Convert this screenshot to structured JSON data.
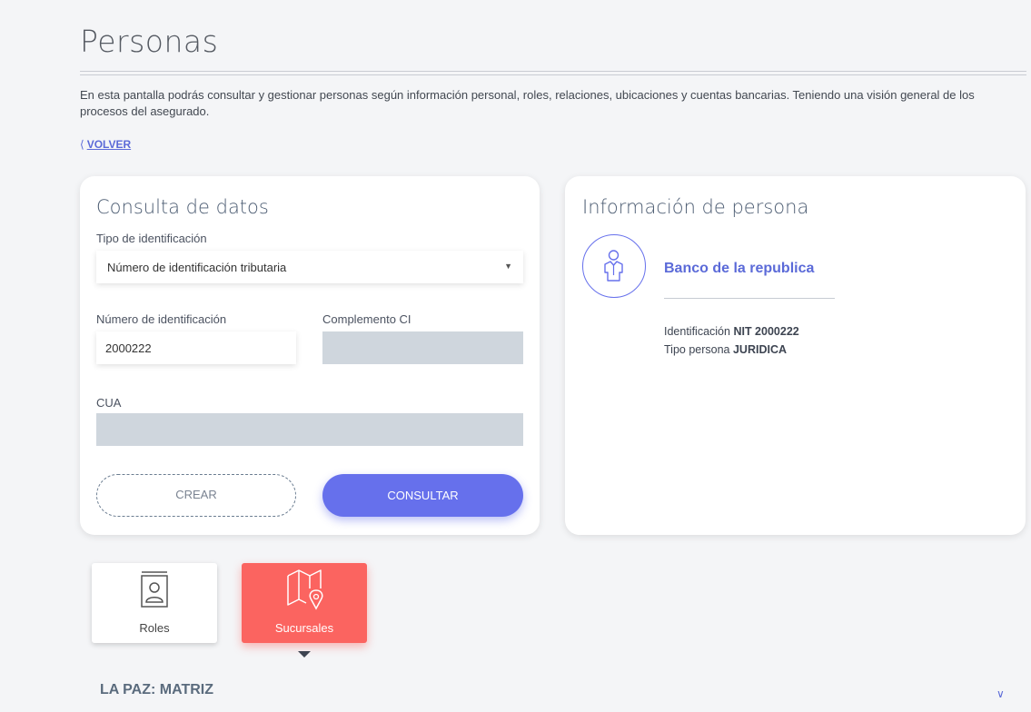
{
  "page": {
    "title": "Personas",
    "intro": "En esta pantalla podrás consultar y gestionar personas según información personal, roles, relaciones, ubicaciones y cuentas bancarias. Teniendo una visión general de los procesos del asegurado.",
    "back_label": "VOLVER"
  },
  "query": {
    "title": "Consulta de datos",
    "id_type_label": "Tipo de identificación",
    "id_type_value": "Número de identificación tributaria",
    "id_number_label": "Número de identificación",
    "id_number_value": "2000222",
    "complement_label": "Complemento CI",
    "complement_value": "",
    "cua_label": "CUA",
    "cua_value": "",
    "create_label": "CREAR",
    "consult_label": "CONSULTAR"
  },
  "info": {
    "title": "Información de persona",
    "name": "Banco de la republica",
    "identification_label": "Identificación",
    "identification_value": "NIT 2000222",
    "person_type_label": "Tipo persona",
    "person_type_value": "JURIDICA"
  },
  "tabs": [
    {
      "label": "Roles",
      "icon": "address-book-icon",
      "active": false
    },
    {
      "label": "Sucursales",
      "icon": "map-pin-icon",
      "active": true
    }
  ],
  "section": {
    "title": "LA PAZ: MATRIZ"
  },
  "colors": {
    "accent": "#6670ec",
    "active_tab": "#fb6460",
    "disabled_input": "#cfd6dd"
  }
}
